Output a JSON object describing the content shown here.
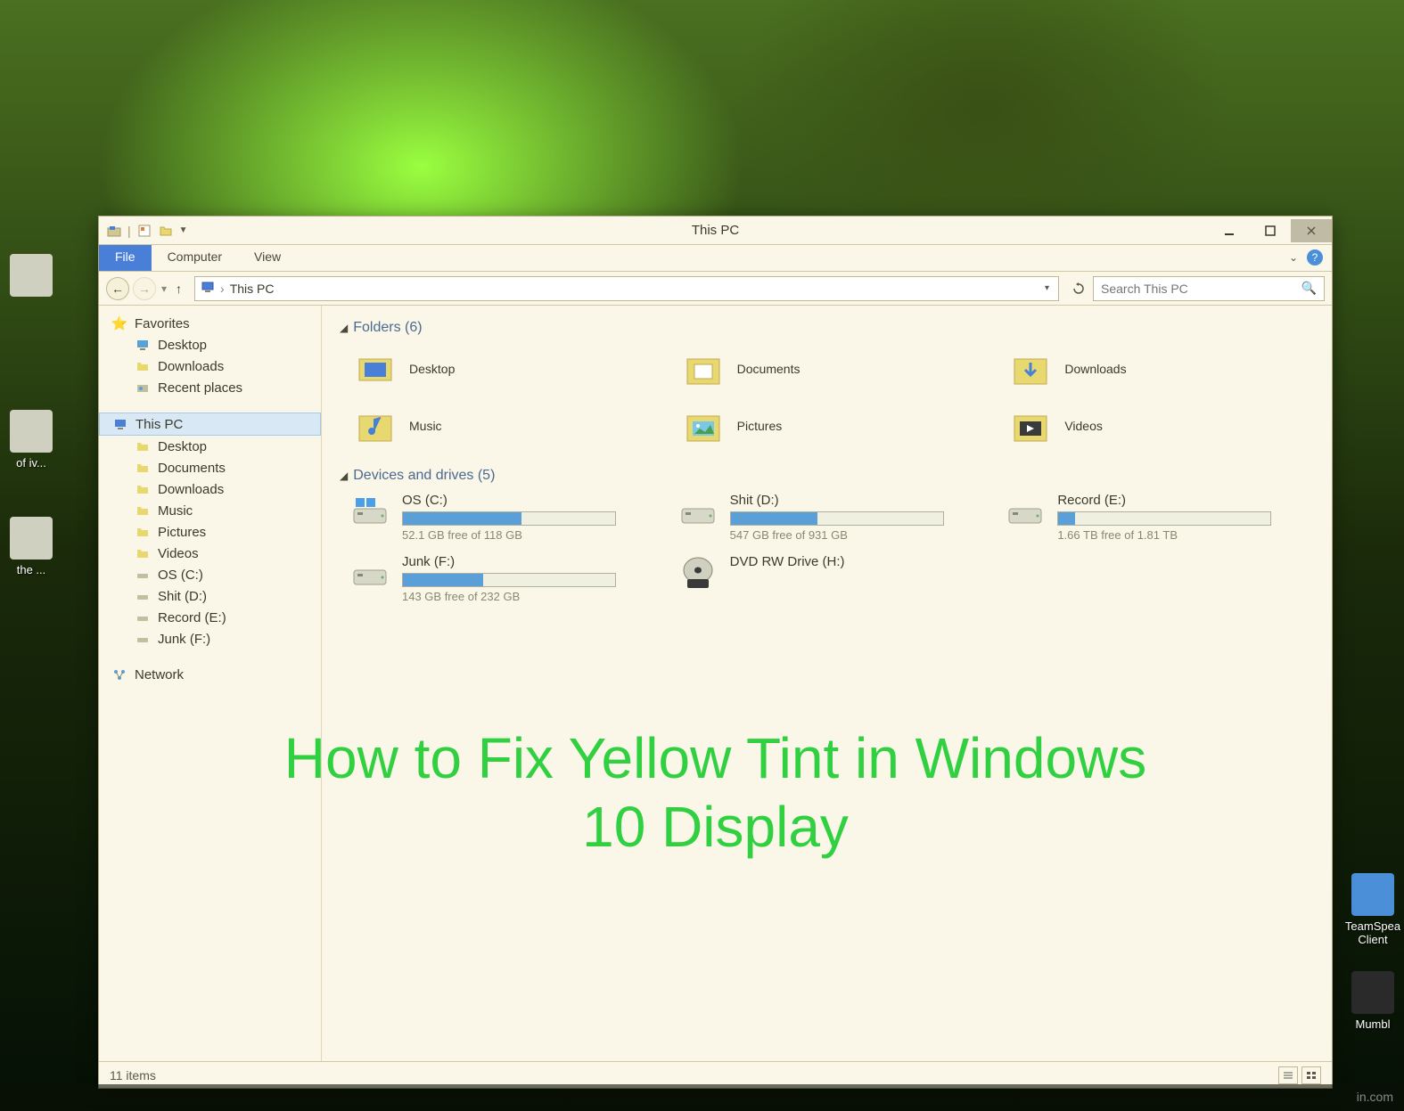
{
  "window": {
    "title": "This PC",
    "ribbon": {
      "file": "File",
      "computer": "Computer",
      "view": "View"
    },
    "address": {
      "location": "This PC"
    },
    "search": {
      "placeholder": "Search This PC"
    }
  },
  "sidebar": {
    "favorites": {
      "label": "Favorites",
      "items": [
        {
          "label": "Desktop",
          "icon": "desktop"
        },
        {
          "label": "Downloads",
          "icon": "downloads"
        },
        {
          "label": "Recent places",
          "icon": "recent"
        }
      ]
    },
    "thispc": {
      "label": "This PC",
      "items": [
        {
          "label": "Desktop",
          "icon": "desktop"
        },
        {
          "label": "Documents",
          "icon": "documents"
        },
        {
          "label": "Downloads",
          "icon": "downloads"
        },
        {
          "label": "Music",
          "icon": "music"
        },
        {
          "label": "Pictures",
          "icon": "pictures"
        },
        {
          "label": "Videos",
          "icon": "videos"
        },
        {
          "label": "OS (C:)",
          "icon": "drive"
        },
        {
          "label": "Shit (D:)",
          "icon": "drive"
        },
        {
          "label": "Record (E:)",
          "icon": "drive"
        },
        {
          "label": "Junk (F:)",
          "icon": "drive"
        }
      ]
    },
    "network": {
      "label": "Network"
    }
  },
  "sections": {
    "folders": {
      "label": "Folders (6)",
      "items": [
        {
          "label": "Desktop"
        },
        {
          "label": "Documents"
        },
        {
          "label": "Downloads"
        },
        {
          "label": "Music"
        },
        {
          "label": "Pictures"
        },
        {
          "label": "Videos"
        }
      ]
    },
    "drives": {
      "label": "Devices and drives (5)",
      "items": [
        {
          "name": "OS (C:)",
          "free": "52.1 GB free of 118 GB",
          "fill": 56
        },
        {
          "name": "Shit (D:)",
          "free": "547 GB free of 931 GB",
          "fill": 41
        },
        {
          "name": "Record (E:)",
          "free": "1.66 TB free of 1.81 TB",
          "fill": 8
        },
        {
          "name": "Junk (F:)",
          "free": "143 GB free of 232 GB",
          "fill": 38
        },
        {
          "name": "DVD RW Drive (H:)",
          "free": "",
          "fill": -1,
          "dvd": true
        }
      ]
    }
  },
  "status": {
    "items": "11 items"
  },
  "overlay": {
    "title": "How to Fix Yellow Tint in Windows 10 Display"
  },
  "desktop_icons": {
    "left1": "of iv...",
    "left2": "the ...",
    "right1": "TeamSpea Client",
    "right2": "Mumbl"
  },
  "watermark": "in.com"
}
